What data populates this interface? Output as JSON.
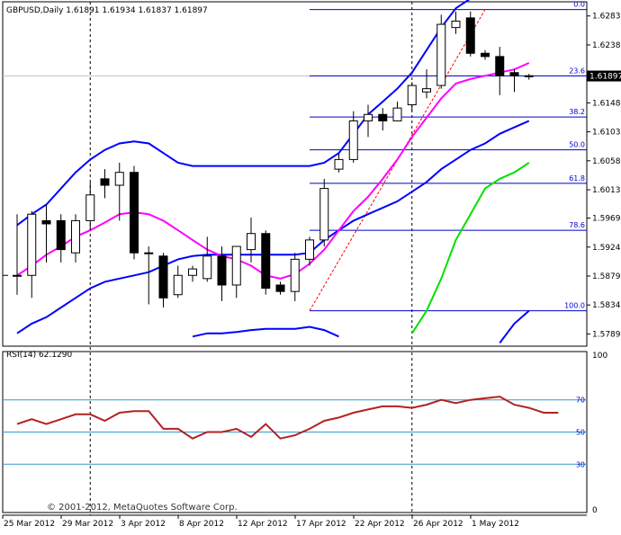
{
  "chart_data": {
    "type": "candlestick",
    "main": {
      "title": "GBPUSD,Daily",
      "ohlc_text": "1.61891 1.61934 1.61837 1.61897",
      "current_price": 1.61897,
      "current_price_label": "1.61897",
      "ylim": [
        1.577,
        1.6305
      ],
      "price_ticks": [
        1.6283,
        1.6238,
        1.6193,
        1.6148,
        1.6103,
        1.6058,
        1.6013,
        1.5969,
        1.5924,
        1.5879,
        1.5834,
        1.5789
      ],
      "price_tick_labels": [
        "1.62830",
        "1.62380",
        "1.61930",
        "1.61480",
        "1.61030",
        "1.60580",
        "1.60130",
        "1.59690",
        "1.59240",
        "1.58790",
        "1.58340",
        "1.57890"
      ],
      "candles": [
        {
          "o": 1.588,
          "h": 1.5975,
          "l": 1.585,
          "c": 1.588
        },
        {
          "o": 1.588,
          "h": 1.598,
          "l": 1.5845,
          "c": 1.5975
        },
        {
          "o": 1.5965,
          "h": 1.599,
          "l": 1.59,
          "c": 1.596
        },
        {
          "o": 1.5965,
          "h": 1.5975,
          "l": 1.59,
          "c": 1.592
        },
        {
          "o": 1.5915,
          "h": 1.5975,
          "l": 1.59,
          "c": 1.5965
        },
        {
          "o": 1.5965,
          "h": 1.6025,
          "l": 1.595,
          "c": 1.6005
        },
        {
          "o": 1.603,
          "h": 1.6045,
          "l": 1.6,
          "c": 1.602
        },
        {
          "o": 1.602,
          "h": 1.6055,
          "l": 1.5965,
          "c": 1.604
        },
        {
          "o": 1.604,
          "h": 1.605,
          "l": 1.5905,
          "c": 1.5915
        },
        {
          "o": 1.5915,
          "h": 1.5925,
          "l": 1.5835,
          "c": 1.5915
        },
        {
          "o": 1.591,
          "h": 1.5915,
          "l": 1.583,
          "c": 1.5845
        },
        {
          "o": 1.585,
          "h": 1.5895,
          "l": 1.5845,
          "c": 1.588
        },
        {
          "o": 1.588,
          "h": 1.5895,
          "l": 1.587,
          "c": 1.589
        },
        {
          "o": 1.5875,
          "h": 1.594,
          "l": 1.587,
          "c": 1.591
        },
        {
          "o": 1.591,
          "h": 1.5925,
          "l": 1.584,
          "c": 1.5865
        },
        {
          "o": 1.5865,
          "h": 1.592,
          "l": 1.5845,
          "c": 1.5925
        },
        {
          "o": 1.592,
          "h": 1.597,
          "l": 1.59,
          "c": 1.5945
        },
        {
          "o": 1.5945,
          "h": 1.595,
          "l": 1.585,
          "c": 1.586
        },
        {
          "o": 1.5865,
          "h": 1.587,
          "l": 1.585,
          "c": 1.5855
        },
        {
          "o": 1.5855,
          "h": 1.5915,
          "l": 1.584,
          "c": 1.5905
        },
        {
          "o": 1.5905,
          "h": 1.594,
          "l": 1.5895,
          "c": 1.5935
        },
        {
          "o": 1.5935,
          "h": 1.603,
          "l": 1.5925,
          "c": 1.6015
        },
        {
          "o": 1.6045,
          "h": 1.607,
          "l": 1.604,
          "c": 1.606
        },
        {
          "o": 1.606,
          "h": 1.6135,
          "l": 1.6055,
          "c": 1.612
        },
        {
          "o": 1.612,
          "h": 1.6145,
          "l": 1.6095,
          "c": 1.613
        },
        {
          "o": 1.613,
          "h": 1.614,
          "l": 1.6105,
          "c": 1.612
        },
        {
          "o": 1.612,
          "h": 1.615,
          "l": 1.612,
          "c": 1.614
        },
        {
          "o": 1.6145,
          "h": 1.618,
          "l": 1.6135,
          "c": 1.6175
        },
        {
          "o": 1.6165,
          "h": 1.62,
          "l": 1.6155,
          "c": 1.617
        },
        {
          "o": 1.6175,
          "h": 1.6285,
          "l": 1.617,
          "c": 1.627
        },
        {
          "o": 1.6265,
          "h": 1.629,
          "l": 1.6255,
          "c": 1.6275
        },
        {
          "o": 1.628,
          "h": 1.629,
          "l": 1.622,
          "c": 1.6225
        },
        {
          "o": 1.6225,
          "h": 1.623,
          "l": 1.6215,
          "c": 1.622
        },
        {
          "o": 1.622,
          "h": 1.6235,
          "l": 1.616,
          "c": 1.619
        },
        {
          "o": 1.6195,
          "h": 1.62,
          "l": 1.6165,
          "c": 1.619
        },
        {
          "o": 1.6189,
          "h": 1.6193,
          "l": 1.6184,
          "c": 1.619
        }
      ],
      "fibonacci": {
        "levels": [
          {
            "label": "0.0",
            "price": 1.6293
          },
          {
            "label": "23.6",
            "price": 1.619
          },
          {
            "label": "38.2",
            "price": 1.6126
          },
          {
            "label": "50.0",
            "price": 1.6075
          },
          {
            "label": "61.8",
            "price": 1.6023
          },
          {
            "label": "78.6",
            "price": 1.595
          },
          {
            "label": "100.0",
            "price": 1.5825
          }
        ],
        "trend_from": {
          "bar": 20,
          "price": 1.5825
        },
        "trend_to": {
          "bar": 32,
          "price": 1.6293
        }
      },
      "current_price_line": 1.619,
      "period_separators": [
        5,
        27
      ],
      "indicator_lines": [
        {
          "color": "#0000ff",
          "values": [
            1.5958,
            1.5975,
            1.599,
            1.6015,
            1.604,
            1.606,
            1.6075,
            1.6085,
            1.6088,
            1.6085,
            1.607,
            1.6055,
            1.605,
            1.605,
            1.605,
            1.605,
            1.605,
            1.605,
            1.605,
            1.605,
            1.605,
            1.6055,
            1.607,
            1.61,
            1.613,
            1.615,
            1.617,
            1.6195,
            1.623,
            1.6265,
            1.6295,
            1.631,
            null,
            null,
            null,
            null
          ]
        },
        {
          "color": "#0000ff",
          "values": [
            1.579,
            1.5805,
            1.5815,
            1.583,
            1.5845,
            1.586,
            1.587,
            1.5875,
            1.588,
            1.5885,
            1.5895,
            1.5905,
            1.591,
            1.5912,
            1.5912,
            1.5912,
            1.5912,
            1.5912,
            1.5912,
            1.5912,
            1.5915,
            1.5935,
            1.595,
            1.5965,
            1.5975,
            1.5985,
            1.5995,
            1.601,
            1.6025,
            1.6045,
            1.606,
            1.6075,
            1.6085,
            1.61,
            1.611,
            1.612
          ]
        },
        {
          "color": "#0000ff",
          "values": [
            null,
            null,
            null,
            null,
            null,
            null,
            null,
            null,
            null,
            null,
            null,
            null,
            1.5785,
            1.579,
            1.579,
            1.5792,
            1.5795,
            1.5797,
            1.5797,
            1.5797,
            1.58,
            1.5795,
            1.5785,
            null,
            null,
            null,
            null,
            null,
            null,
            null,
            null,
            null,
            null,
            1.5775,
            1.5805,
            1.5825
          ]
        },
        {
          "color": "#ff00ff",
          "values": [
            1.588,
            1.5895,
            1.5912,
            1.5925,
            1.594,
            1.595,
            1.5962,
            1.5975,
            1.5978,
            1.5975,
            1.5965,
            1.595,
            1.5935,
            1.592,
            1.591,
            1.5905,
            1.5895,
            1.588,
            1.5875,
            1.5882,
            1.5898,
            1.592,
            1.595,
            1.598,
            1.6002,
            1.603,
            1.606,
            1.6095,
            1.6125,
            1.6155,
            1.6178,
            1.6185,
            1.619,
            1.6195,
            1.62,
            1.621
          ]
        },
        {
          "color": "#00e000",
          "values": [
            null,
            null,
            null,
            null,
            null,
            null,
            null,
            null,
            null,
            null,
            null,
            null,
            null,
            null,
            null,
            null,
            null,
            null,
            null,
            null,
            null,
            null,
            null,
            null,
            null,
            null,
            null,
            1.579,
            1.5825,
            1.5875,
            1.5935,
            1.5975,
            1.6015,
            1.603,
            1.604,
            1.6055
          ]
        }
      ]
    },
    "rsi": {
      "title": "RSI(14) 62.1290",
      "ylim": [
        0,
        100
      ],
      "ticks": [
        100,
        0
      ],
      "levels": [
        70,
        50,
        30
      ],
      "level_labels": [
        "70",
        "50",
        "30"
      ],
      "tick_labels": [
        "100",
        "0"
      ],
      "values": [
        55,
        58,
        55,
        58,
        61,
        61,
        57,
        62,
        63,
        63,
        52,
        52,
        46,
        50,
        50,
        52,
        47,
        55,
        46,
        48,
        52,
        57,
        59,
        62,
        64,
        66,
        66,
        65,
        67,
        70,
        68,
        70,
        71,
        72,
        67,
        65,
        62,
        62
      ]
    },
    "x_axis": {
      "labels": [
        "25 Mar 2012",
        "29 Mar 2012",
        "3 Apr 2012",
        "8 Apr 2012",
        "12 Apr 2012",
        "17 Apr 2012",
        "22 Apr 2012",
        "26 Apr 2012",
        "1 May 2012"
      ],
      "label_bars": [
        0,
        4,
        8,
        12,
        16,
        20,
        24,
        28,
        32
      ]
    },
    "copyright": "© 2001-2012, MetaQuotes Software Corp."
  }
}
